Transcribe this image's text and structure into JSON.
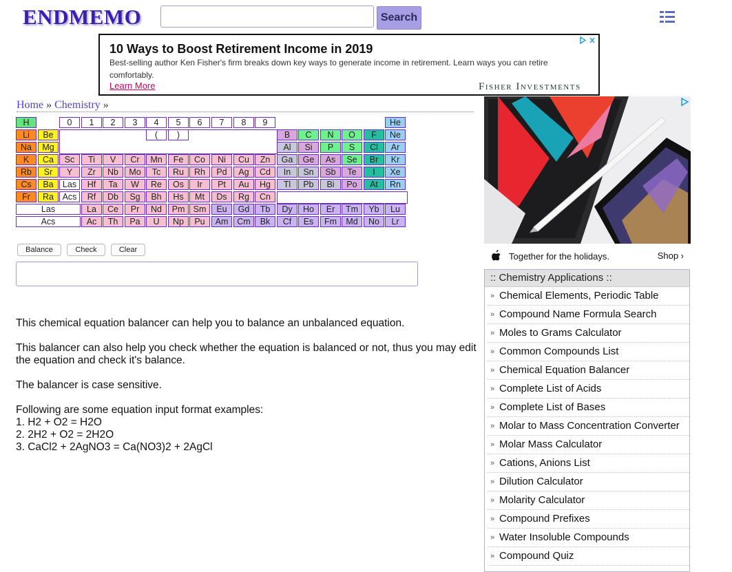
{
  "header": {
    "logo": "ENDMEMO",
    "search_placeholder": "",
    "search_button": "Search"
  },
  "ad_top": {
    "title": "10 Ways to Boost Retirement Income in 2019",
    "description": "Best-selling author Ken Fisher's firm breaks down key ways to generate income in retirement. Learn ways you can retire comfortably.",
    "link": "Learn More",
    "brand": "Fisher Investments"
  },
  "breadcrumb": {
    "home": "Home",
    "sep": "»",
    "chemistry": "Chemistry",
    "sep2": "»"
  },
  "periodic_table": {
    "top_numbers": [
      "0",
      "1",
      "2",
      "3",
      "4",
      "5",
      "6",
      "7",
      "8",
      "9"
    ],
    "brackets": [
      "(",
      ")"
    ],
    "rows": [
      [
        "H",
        "He"
      ],
      [
        "Li",
        "Be",
        "B",
        "C",
        "N",
        "O",
        "F",
        "Ne"
      ],
      [
        "Na",
        "Mg",
        "Al",
        "Si",
        "P",
        "S",
        "Cl",
        "Ar"
      ],
      [
        "K",
        "Ca",
        "Sc",
        "Ti",
        "V",
        "Cr",
        "Mn",
        "Fe",
        "Co",
        "Ni",
        "Cu",
        "Zn",
        "Ga",
        "Ge",
        "As",
        "Se",
        "Br",
        "Kr"
      ],
      [
        "Rb",
        "Sr",
        "Y",
        "Zr",
        "Nb",
        "Mo",
        "Tc",
        "Ru",
        "Rh",
        "Pd",
        "Ag",
        "Cd",
        "In",
        "Sn",
        "Sb",
        "Te",
        "I",
        "Xe"
      ],
      [
        "Cs",
        "Ba",
        "Las",
        "Hf",
        "Ta",
        "W",
        "Re",
        "Os",
        "Ir",
        "Pt",
        "Au",
        "Hg",
        "Tl",
        "Pb",
        "Bi",
        "Po",
        "At",
        "Rn"
      ],
      [
        "Fr",
        "Ra",
        "Acs",
        "Rf",
        "Db",
        "Sg",
        "Bh",
        "Hs",
        "Mt",
        "Ds",
        "Rg",
        "Cn"
      ]
    ],
    "lanthanides_label": "Las",
    "lanthanides": [
      "La",
      "Ce",
      "Pr",
      "Nd",
      "Pm",
      "Sm",
      "Eu",
      "Gd",
      "Tb",
      "Dy",
      "Ho",
      "Er",
      "Tm",
      "Yb",
      "Lu"
    ],
    "actinides_label": "Acs",
    "actinides": [
      "Ac",
      "Th",
      "Pa",
      "U",
      "Np",
      "Pu",
      "Am",
      "Cm",
      "Bk",
      "Cf",
      "Es",
      "Fm",
      "Md",
      "No",
      "Lr"
    ]
  },
  "controls": {
    "balance": "Balance",
    "check": "Check",
    "clear": "Clear",
    "equation_value": ""
  },
  "content": {
    "p1": "This chemical equation balancer can help you to balance an unbalanced equation.",
    "p2": "This balancer can also help you check whether the equation is balanced or not, thus you may edit the equation and check it's balance.",
    "p3": "The balancer is case sensitive.",
    "p4": "Following are some equation input format examples:",
    "examples": [
      "1. H2 + O2 = H2O",
      "2. 2H2 + O2 = 2H2O",
      "3. CaCl2 + 2AgNO3 = Ca(NO3)2 + 2AgCl"
    ]
  },
  "ad_side": {
    "tagline": "Together for the holidays.",
    "shop": "Shop ›"
  },
  "apps": {
    "header": ":: Chemistry Applications ::",
    "items": [
      "Chemical Elements, Periodic Table",
      "Compound Name Formula Search",
      "Moles to Grams Calculator",
      "Common Compounds List",
      "Chemical Equation Balancer",
      "Complete List of Acids",
      "Complete List of Bases",
      "Molar to Mass Concentration Converter",
      "Molar Mass Calculator",
      "Cations, Anions List",
      "Dilution Calculator",
      "Molarity Calculator",
      "Compound Prefixes",
      "Water Insoluble Compounds",
      "Compound Quiz"
    ]
  },
  "colors": {
    "brand": "#3c1fae",
    "link": "#5a3fcf",
    "search_button": "#a79ee6",
    "ad_link": "#d00060"
  }
}
